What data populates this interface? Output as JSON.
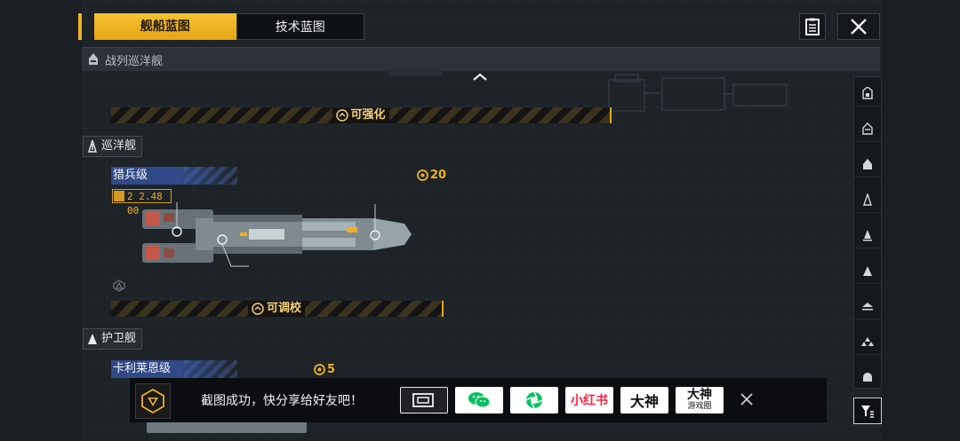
{
  "tabs": [
    {
      "label": "舰船蓝图",
      "active": true
    },
    {
      "label": "技术蓝图",
      "active": false
    }
  ],
  "header": {
    "list_icon": "clipboard-list-icon",
    "close_icon": "close-icon"
  },
  "section": {
    "title": "战列巡洋舰",
    "icon": "battlecruiser-icon"
  },
  "upper_bar": {
    "caption": "可强化"
  },
  "cruiser": {
    "category": "巡洋舰",
    "ship_name": "猎兵级",
    "size": "2 2.48 00",
    "cost": "20",
    "bar_caption": "可调校"
  },
  "frigate": {
    "category": "护卫舰",
    "ship_name": "卡利莱恩级",
    "cost": "5"
  },
  "right_rail": {
    "items": [
      "carrier-icon",
      "battlecruiser-icon",
      "battleship-icon",
      "cruiser-icon",
      "destroyer-icon",
      "frigate-icon",
      "corvette-icon",
      "fighter-icon",
      "auxiliary-icon"
    ]
  },
  "share": {
    "text": "截图成功，快分享给好友吧！",
    "buttons": [
      {
        "name": "screen-share",
        "label": ""
      },
      {
        "name": "wechat",
        "label": ""
      },
      {
        "name": "moments",
        "label": ""
      },
      {
        "name": "xiaohongshu",
        "label": "小红书"
      },
      {
        "name": "dashen",
        "label": "大神"
      },
      {
        "name": "dashen-game",
        "label": "大神",
        "sub": "游戏圈"
      }
    ]
  },
  "colors": {
    "accent": "#f0b221",
    "blue": "#2f4a86",
    "wechat": "#07c160",
    "xhs": "#ff2442"
  }
}
